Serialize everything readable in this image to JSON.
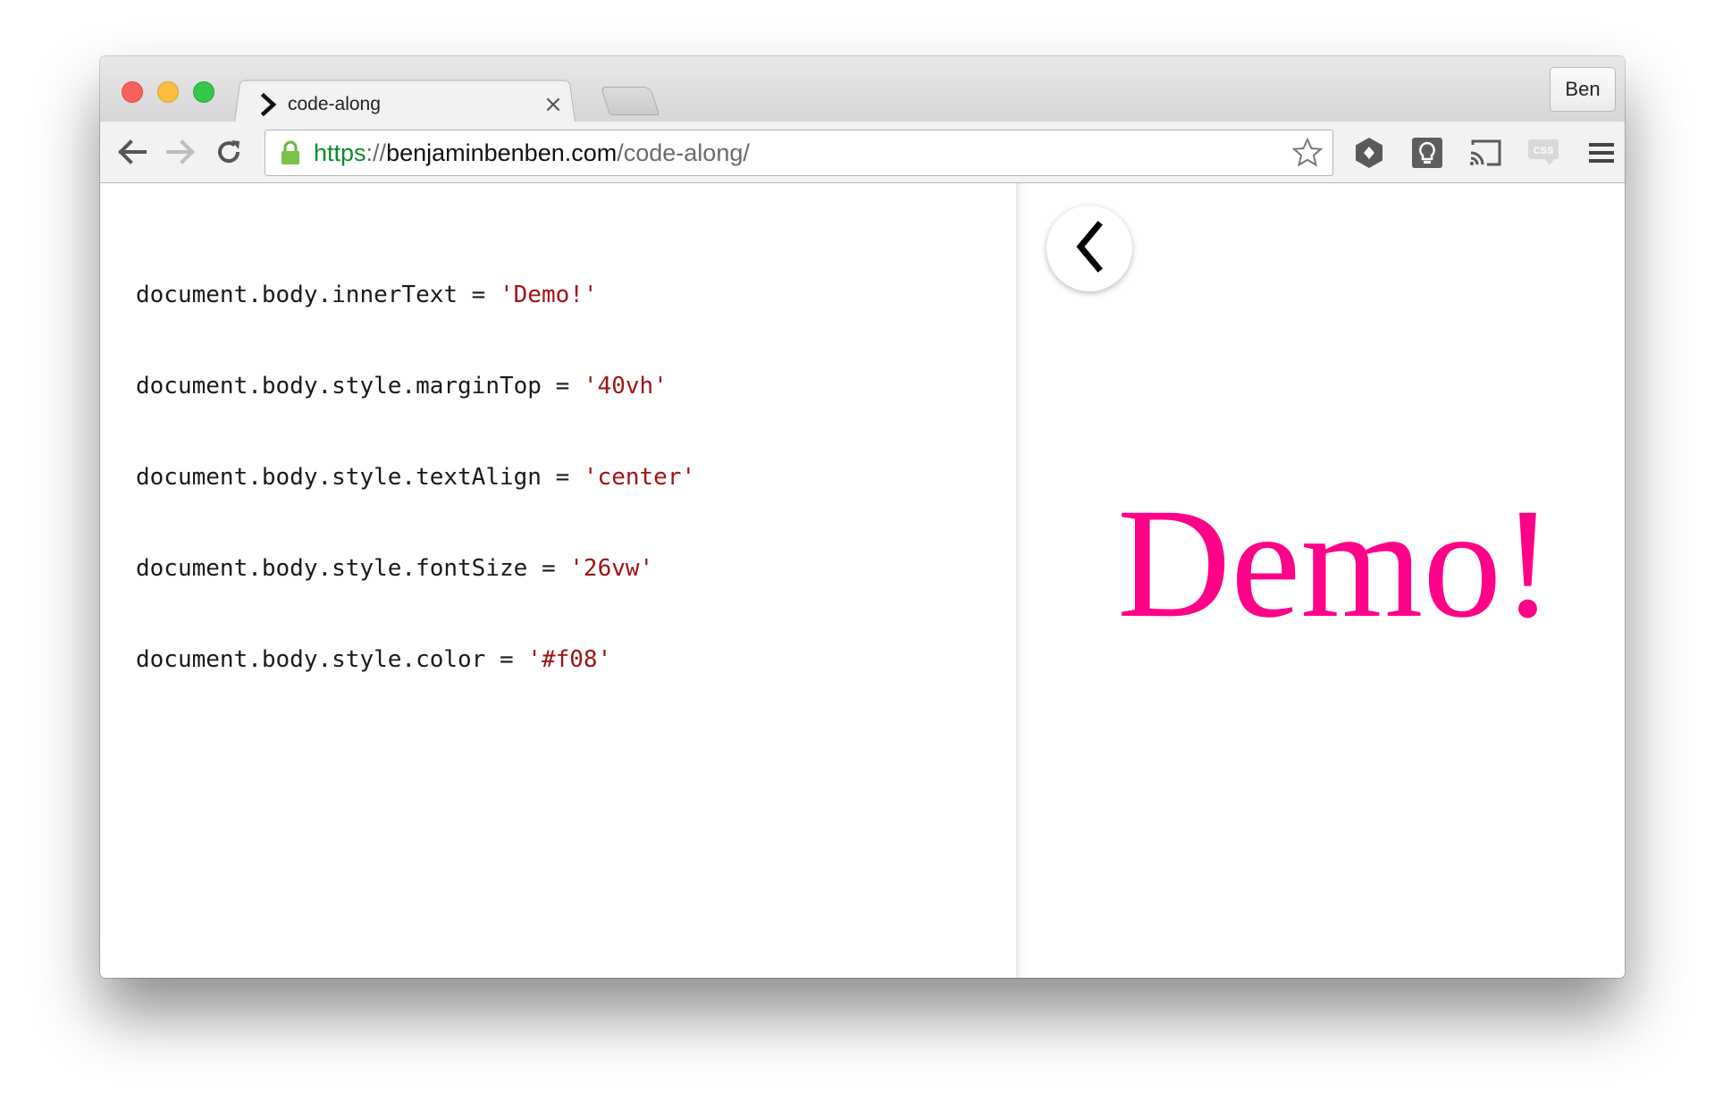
{
  "window": {
    "tab": {
      "title": "code-along",
      "close_glyph": "×"
    },
    "profile_label": "Ben"
  },
  "toolbar": {
    "url": {
      "scheme": "https",
      "separator": "://",
      "host": "benjaminbenben.com",
      "path": "/code-along/"
    },
    "extensions": [
      "extension-hexagon-icon",
      "lightbulb-icon",
      "cast-icon",
      "css-viewer-icon",
      "menu-icon"
    ]
  },
  "editor": {
    "lines": [
      {
        "code": "document.body.innerText = ",
        "value": "'Demo!'"
      },
      {
        "code": "document.body.style.marginTop = ",
        "value": "'40vh'"
      },
      {
        "code": "document.body.style.textAlign = ",
        "value": "'center'"
      },
      {
        "code": "document.body.style.fontSize = ",
        "value": "'26vw'"
      },
      {
        "code": "document.body.style.color = ",
        "value": "'#f08'"
      }
    ]
  },
  "preview": {
    "text": "Demo!",
    "color": "#ff0088"
  },
  "colors": {
    "secure_green": "#0a8b2c",
    "string_red": "#a11313"
  }
}
